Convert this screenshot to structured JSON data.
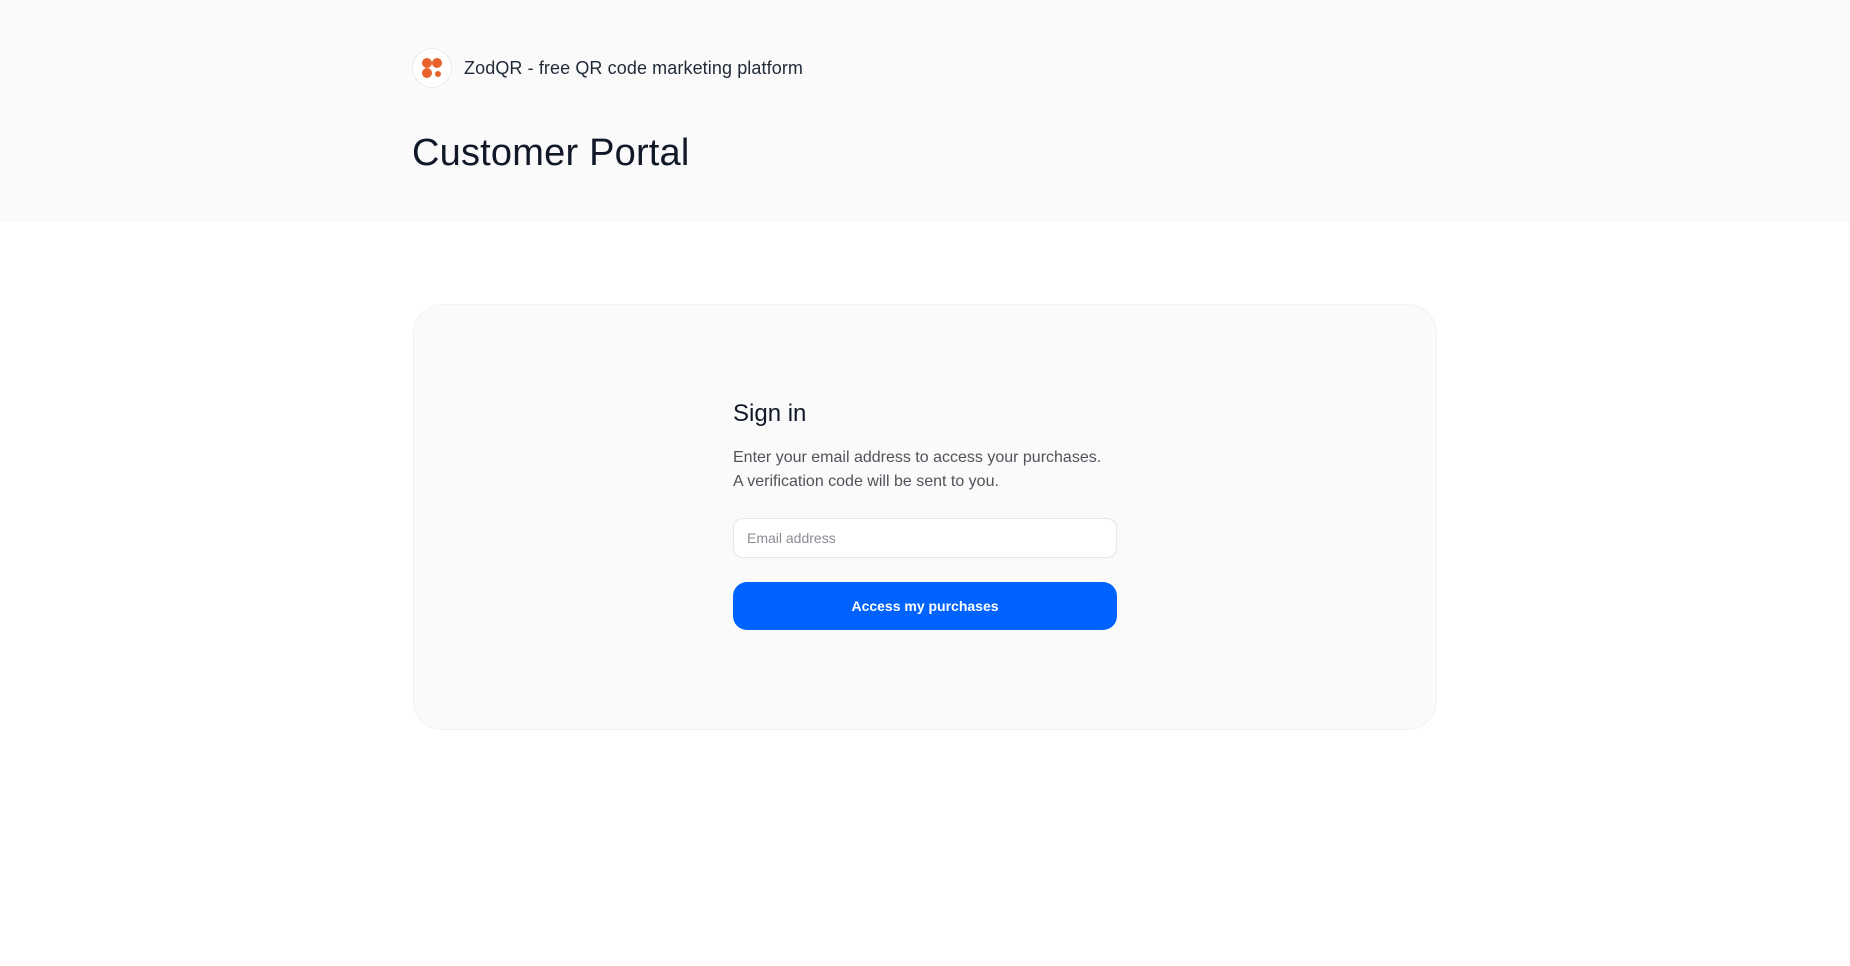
{
  "brand": {
    "name": "ZodQR - free QR code marketing platform",
    "logo_icon": "orange-dots-logo-icon",
    "logo_color": "#e8622c"
  },
  "page": {
    "title": "Customer Portal"
  },
  "signin": {
    "title": "Sign in",
    "description_line1": "Enter your email address to access your purchases.",
    "description_line2": "A verification code will be sent to you.",
    "email_placeholder": "Email address",
    "email_value": "",
    "submit_label": "Access my purchases",
    "accent_color": "#0062ff"
  }
}
